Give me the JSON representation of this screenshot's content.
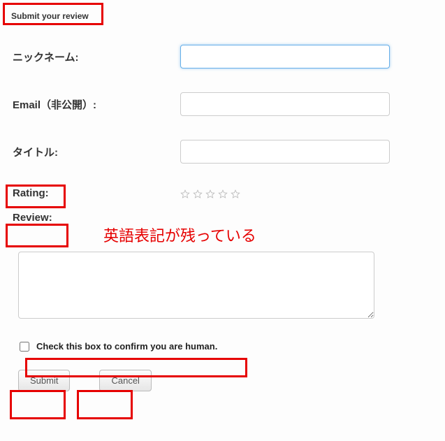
{
  "heading": "Submit your review",
  "labels": {
    "nickname": "ニックネーム:",
    "email": "Email（非公開）:",
    "title": "タイトル:",
    "rating": "Rating:",
    "review": "Review:"
  },
  "inputs": {
    "nickname_value": "",
    "email_value": "",
    "title_value": "",
    "textarea_value": ""
  },
  "stars": {
    "count": 5,
    "filled": 0
  },
  "annotation": "英語表記が残っている",
  "checkbox": {
    "label": "Check this box to confirm you are human.",
    "checked": false
  },
  "buttons": {
    "submit": "Submit",
    "cancel": "Cancel"
  },
  "colors": {
    "highlight": "#e60000"
  }
}
